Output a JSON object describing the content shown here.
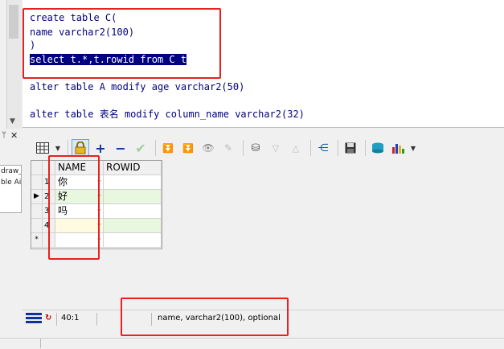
{
  "editor": {
    "lines": [
      "create table C(",
      "name varchar2(100)",
      ")",
      "select t.*,t.rowid from C t",
      "alter table A modify age varchar2(50)",
      "alter table ",
      "表名",
      " modify column_name varchar2(32)"
    ]
  },
  "left_panel": {
    "items": [
      "draw_i",
      "ble Ai"
    ]
  },
  "toolbar": {
    "icons": [
      "grid-icon",
      "dropdown-arrow-icon",
      "lock-icon",
      "add-record-icon",
      "delete-record-icon",
      "post-icon",
      "fetch-next-icon",
      "fetch-last-icon",
      "find-icon",
      "clear-icon",
      "query-icon",
      "filter-down-icon",
      "filter-up-icon",
      "hierarchy-icon",
      "save-icon",
      "export-icon",
      "chart-icon"
    ]
  },
  "grid": {
    "headers": [
      "NAME",
      "ROWID"
    ],
    "rows": [
      {
        "num": "1",
        "name": "你",
        "rowid": ""
      },
      {
        "num": "2",
        "name": "好",
        "rowid": ""
      },
      {
        "num": "3",
        "name": "吗",
        "rowid": ""
      },
      {
        "num": "4",
        "name": "",
        "rowid": ""
      }
    ],
    "new_row_marker": "*",
    "dots": "··"
  },
  "statusbar": {
    "position": "40:1",
    "hint": "name, varchar2(100), optional"
  },
  "colors": {
    "sql_text": "#000080",
    "selection": "#000080",
    "highlight_border": "#e82020",
    "row_green": "#e8f7e0",
    "row_yellow": "#fffbe0"
  }
}
